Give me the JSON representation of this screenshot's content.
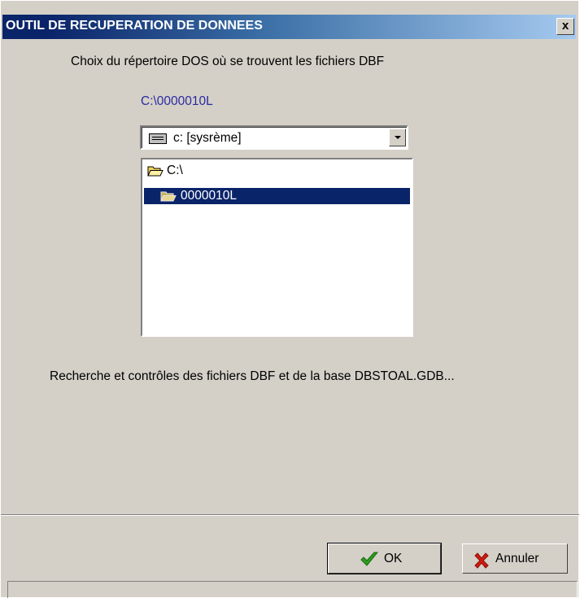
{
  "window": {
    "title": "OUTIL DE RECUPERATION DE DONNEES",
    "close_label": "x"
  },
  "main": {
    "instruction": "Choix du répertoire DOS où se trouvent les fichiers  DBF",
    "current_path": "C:\\0000010L",
    "drive_select": {
      "value": "c: [sysrème]",
      "icon": "drive-icon"
    },
    "directories": [
      {
        "label": "C:\\",
        "icon": "open-folder-icon",
        "selected": false
      },
      {
        "label": "0000010L",
        "icon": "open-folder-icon",
        "selected": true
      }
    ],
    "status_message": "Recherche et contrôles des fichiers DBF et de la base  DBSTOAL.GDB..."
  },
  "buttons": {
    "ok_label": "OK",
    "cancel_label": "Annuler"
  },
  "status_bar": {
    "text": ""
  },
  "colors": {
    "titlebar_start": "#0a246a",
    "titlebar_end": "#a6caf0",
    "selection": "#0a246a",
    "path_text": "#2a2aa0",
    "check_green": "#2e9d1e",
    "cross_red": "#d01c10"
  }
}
